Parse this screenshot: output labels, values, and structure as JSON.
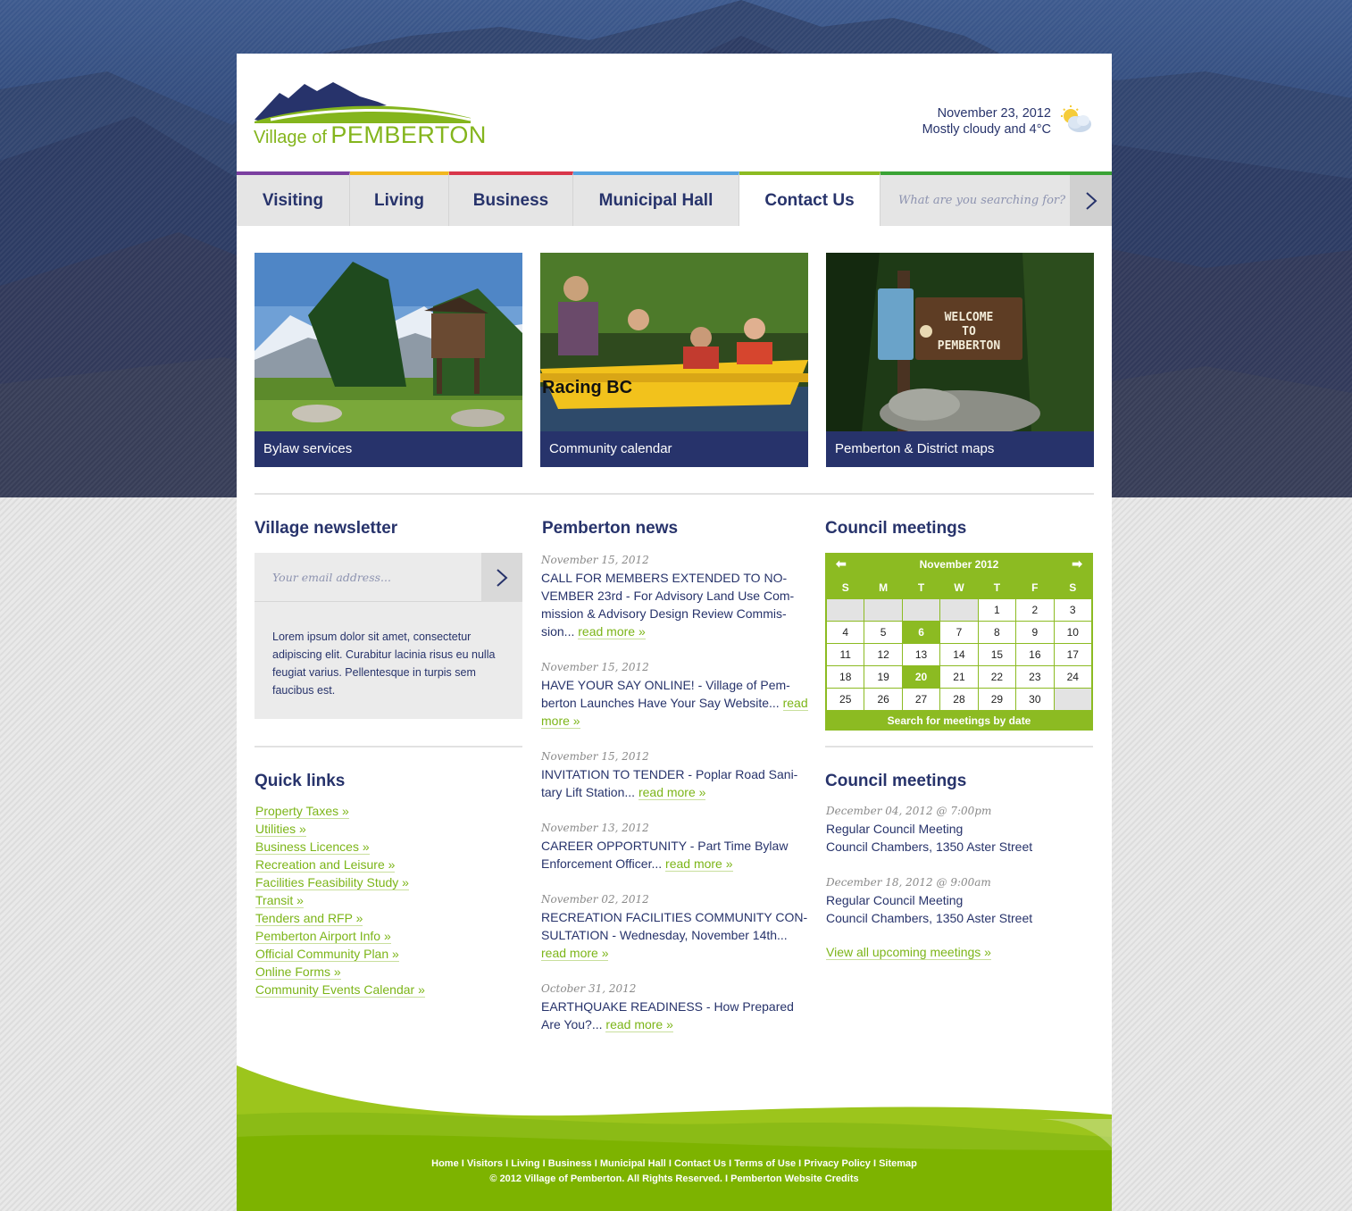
{
  "header": {
    "logo_small": "Village of",
    "logo_big": "PEMBERTON",
    "weather_date": "November 23, 2012",
    "weather_desc": "Mostly cloudy and 4°C",
    "weather_icon": "partly-cloudy-icon"
  },
  "nav": {
    "items": [
      {
        "label": "Visiting",
        "color": "#7b3fa0"
      },
      {
        "label": "Living",
        "color": "#f2b71f"
      },
      {
        "label": "Business",
        "color": "#d8364a"
      },
      {
        "label": "Municipal Hall",
        "color": "#56a3e0"
      },
      {
        "label": "Contact Us",
        "color": "#8cbb22"
      }
    ],
    "search_placeholder": "What are you searching for?"
  },
  "tiles": [
    {
      "caption": "Bylaw services"
    },
    {
      "caption": "Community calendar",
      "image_text": "Racing BC"
    },
    {
      "caption": "Pemberton & District maps",
      "image_text": [
        "WELCOME",
        "TO",
        "PEMBERTON"
      ]
    }
  ],
  "newsletter": {
    "title": "Village newsletter",
    "placeholder": "Your email address...",
    "text": "Lorem ipsum dolor sit amet, consectetur adipiscing elit. Curabitur lacinia risus eu nulla feugiat varius. Pellentesque in turpis sem faucibus est."
  },
  "quick_links": {
    "title": "Quick links",
    "items": [
      "Property Taxes »",
      "Utilities »",
      "Business Licences »",
      "Recreation and Leisure »",
      "Facilities Feasibility Study »",
      "Transit »",
      "Tenders and RFP »",
      "Pemberton Airport Info »",
      "Official Community Plan »",
      "Online Forms »",
      "Community Events Calendar »"
    ]
  },
  "news": {
    "title": "Pemberton news",
    "read_more": "read more »",
    "items": [
      {
        "date": "November 15, 2012",
        "text": "CALL FOR MEMBERS EXTENDED TO NO-VEMBER 23rd - For Advisory Land Use Com-mission & Advisory Design Review Commis-sion..."
      },
      {
        "date": "November 15, 2012",
        "text": "HAVE YOUR SAY ONLINE! - Village of Pem-berton Launches Have Your Say Website..."
      },
      {
        "date": "November 15, 2012",
        "text": "INVITATION TO TENDER - Poplar Road Sani-tary Lift Station..."
      },
      {
        "date": "November 13, 2012",
        "text": "CAREER OPPORTUNITY - Part Time Bylaw Enforcement Officer..."
      },
      {
        "date": "November 02, 2012",
        "text": "RECREATION FACILITIES COMMUNITY CON-SULTATION - Wednesday, November 14th..."
      },
      {
        "date": "October 31, 2012",
        "text": "EARTHQUAKE READINESS - How Prepared Are You?..."
      }
    ]
  },
  "calendar": {
    "title": "Council meetings",
    "month": "November 2012",
    "days": [
      "S",
      "M",
      "T",
      "W",
      "T",
      "F",
      "S"
    ],
    "leading_blanks": 4,
    "trailing_blanks": 1,
    "day_count": 30,
    "highlighted": [
      6,
      20
    ],
    "footer": "Search for meetings by date",
    "accent": "#8cbb22"
  },
  "meetings": {
    "title": "Council meetings",
    "items": [
      {
        "date": "December 04, 2012 @ 7:00pm",
        "name": "Regular Council Meeting",
        "location": "Council Chambers, 1350 Aster Street"
      },
      {
        "date": "December 18, 2012 @ 9:00am",
        "name": "Regular Council Meeting",
        "location": "Council Chambers, 1350 Aster Street"
      }
    ],
    "view_all": "View all upcoming meetings »"
  },
  "footer": {
    "links": [
      "Home",
      "Visitors",
      "Living",
      "Business",
      "Municipal Hall",
      "Contact Us",
      "Terms of Use",
      "Privacy Policy",
      "Sitemap"
    ],
    "copyright": "© 2012 Village of Pemberton. All Rights Reserved. I Pemberton Website Credits"
  }
}
